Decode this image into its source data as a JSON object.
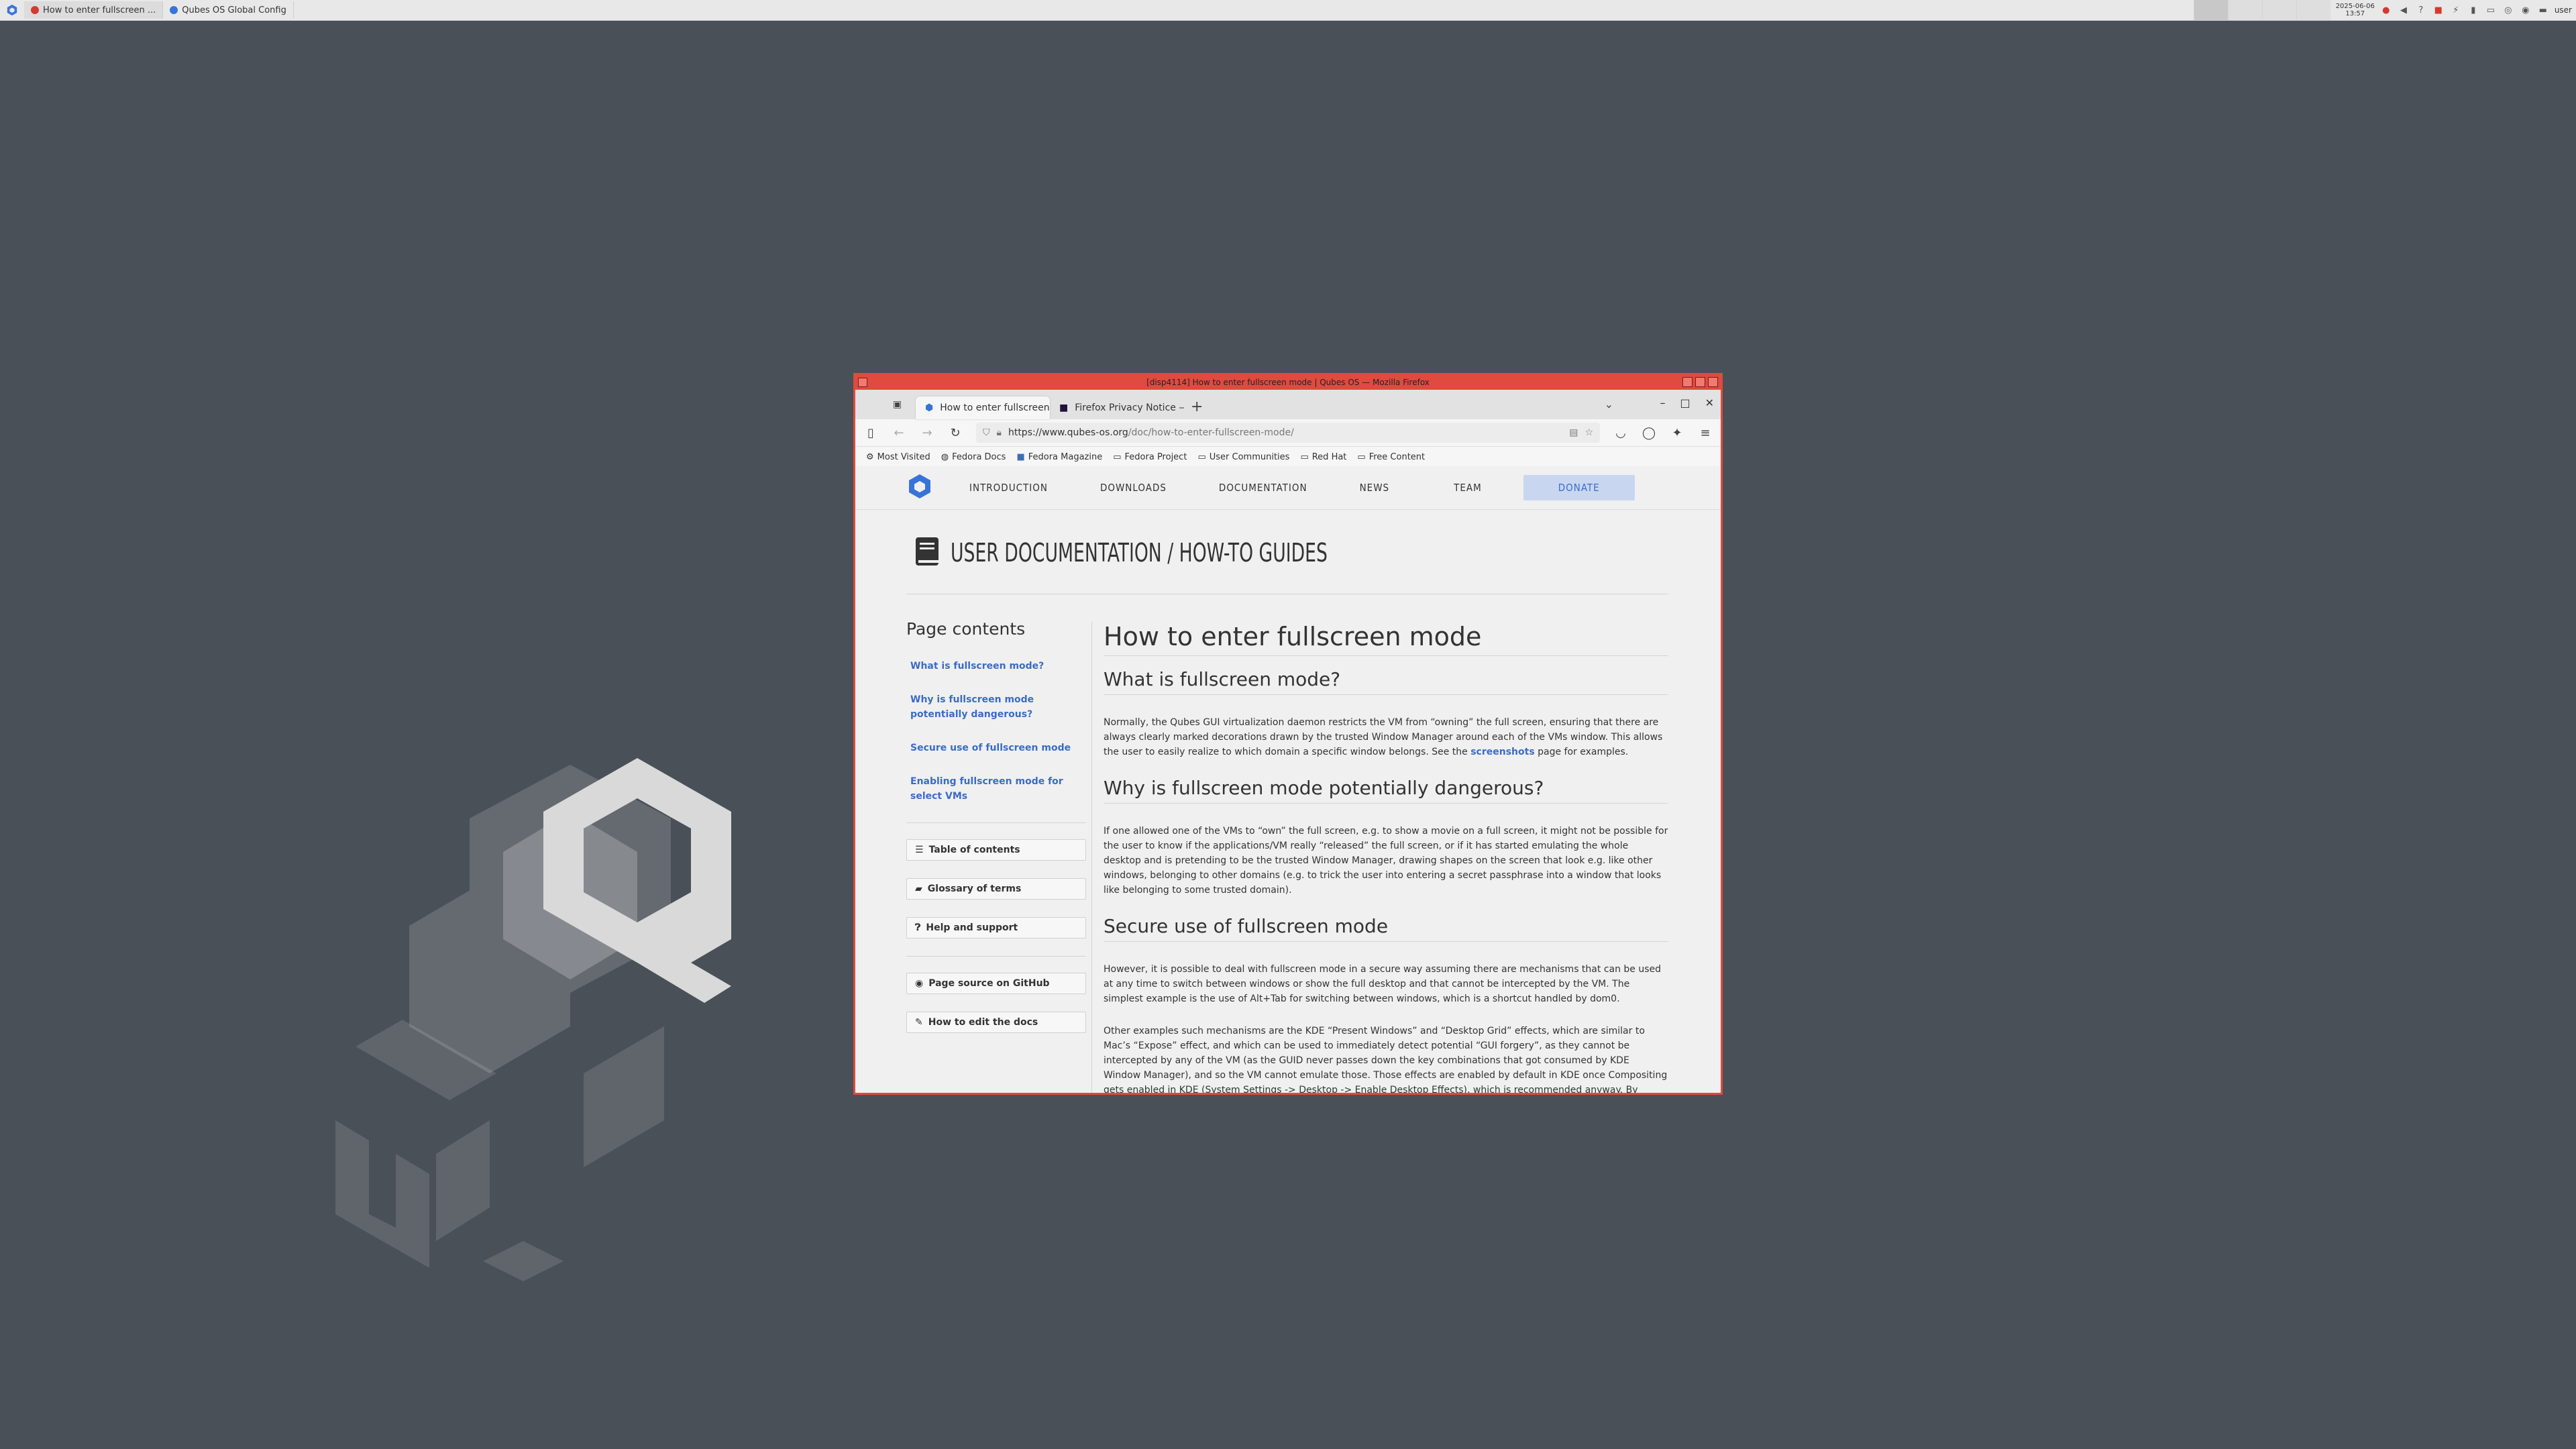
{
  "panel": {
    "tasks": [
      {
        "label": "How to enter fullscreen ...",
        "icon": "firefox-red-icon"
      },
      {
        "label": "Qubes OS Global Config",
        "icon": "qubes-config-icon"
      }
    ],
    "clock": {
      "date": "2025-06-06",
      "time": "13:57"
    },
    "user": "user"
  },
  "window": {
    "title": "[disp4114] How to enter fullscreen mode | Qubes OS — Mozilla Firefox",
    "border_color": "#e04a3f"
  },
  "browser": {
    "tabs": [
      {
        "label": "How to enter fullscreen m",
        "icon": "qubes-favicon"
      },
      {
        "label": "Firefox Privacy Notice — Fi",
        "icon": "firefox-favicon"
      }
    ],
    "url": {
      "host": "https://www.qubes-os.org",
      "path": "/doc/how-to-enter-fullscreen-mode/"
    },
    "bookmarks": [
      "Most Visited",
      "Fedora Docs",
      "Fedora Magazine",
      "Fedora Project",
      "User Communities",
      "Red Hat",
      "Free Content"
    ]
  },
  "site": {
    "nav": [
      "Introduction",
      "Downloads",
      "Documentation",
      "News",
      "Team"
    ],
    "donate": "Donate",
    "section_title": "User documentation / How-to guides",
    "sidebar": {
      "title": "Page contents",
      "toc": [
        "What is fullscreen mode?",
        "Why is fullscreen mode potentially dangerous?",
        "Secure use of fullscreen mode",
        "Enabling fullscreen mode for select VMs"
      ],
      "buttons": [
        "Table of contents",
        "Glossary of terms",
        "Help and support"
      ],
      "buttons2": [
        "Page source on GitHub",
        "How to edit the docs"
      ]
    },
    "article": {
      "title": "How to enter fullscreen mode",
      "h_what": "What is fullscreen mode?",
      "p_what_1": "Normally, the Qubes GUI virtualization daemon restricts the VM from “owning” the full screen, ensuring that there are always clearly marked decorations drawn by the trusted Window Manager around each of the VMs window. This allows the user to easily realize to which domain a specific window belongs. See the ",
      "p_what_link": "screenshots",
      "p_what_2": " page for examples.",
      "h_why": "Why is fullscreen mode potentially dangerous?",
      "p_why": "If one allowed one of the VMs to “own” the full screen, e.g. to show a movie on a full screen, it might not be possible for the user to know if the applications/VM really “released” the full screen, or if it has started emulating the whole desktop and is pretending to be the trusted Window Manager, drawing shapes on the screen that look e.g. like other windows, belonging to other domains (e.g. to trick the user into entering a secret passphrase into a window that looks like belonging to some trusted domain).",
      "h_secure": "Secure use of fullscreen mode",
      "p_secure_1": "However, it is possible to deal with fullscreen mode in a secure way assuming there are mechanisms that can be used at any time to switch between windows or show the full desktop and that cannot be intercepted by the VM. The simplest example is the use of Alt+Tab for switching between windows, which is a shortcut handled by dom0.",
      "p_secure_2": "Other examples such mechanisms are the KDE “Present Windows” and “Desktop Grid” effects, which are similar to Mac’s “Expose” effect, and which can be used to immediately detect potential “GUI forgery”, as they cannot be intercepted by any of the VM (as the GUID never passes down the key combinations that got consumed by KDE Window Manager), and so the VM cannot emulate those. Those effects are enabled by default in KDE once Compositing gets enabled in KDE (System Settings -> Desktop -> Enable Desktop Effects), which is recommended anyway. By default, they are triggered by Ctrl-F8 and Ctrl-F9 key combinations, but can"
    }
  }
}
